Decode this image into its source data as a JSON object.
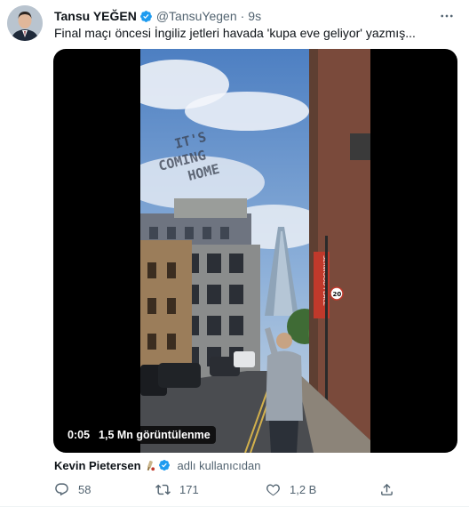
{
  "tweet": {
    "author_name": "Tansu YEĞEN",
    "handle": "@TansuYegen",
    "separator": "·",
    "time": "9s",
    "text": "Final maçı öncesi İngiliz jetleri havada 'kupa eve geliyor' yazmış..."
  },
  "video": {
    "duration": "0:05",
    "views": "1,5 Mn görüntülenme",
    "sky_text": [
      "IT'S",
      "COMING",
      "HOME"
    ],
    "banner_text": "SERWOOD PLACE",
    "sign_number": "20"
  },
  "attribution": {
    "name": "Kevin Pietersen",
    "suffix": "adlı kullanıcıdan"
  },
  "actions": {
    "reply_count": "58",
    "retweet_count": "171",
    "like_count": "1,2 B"
  },
  "colors": {
    "verified": "#1d9bf0",
    "secondary_text": "#536471",
    "primary_text": "#0f1419"
  },
  "icons": [
    "more-icon",
    "verified-icon",
    "reply-icon",
    "retweet-icon",
    "like-icon",
    "share-icon"
  ]
}
